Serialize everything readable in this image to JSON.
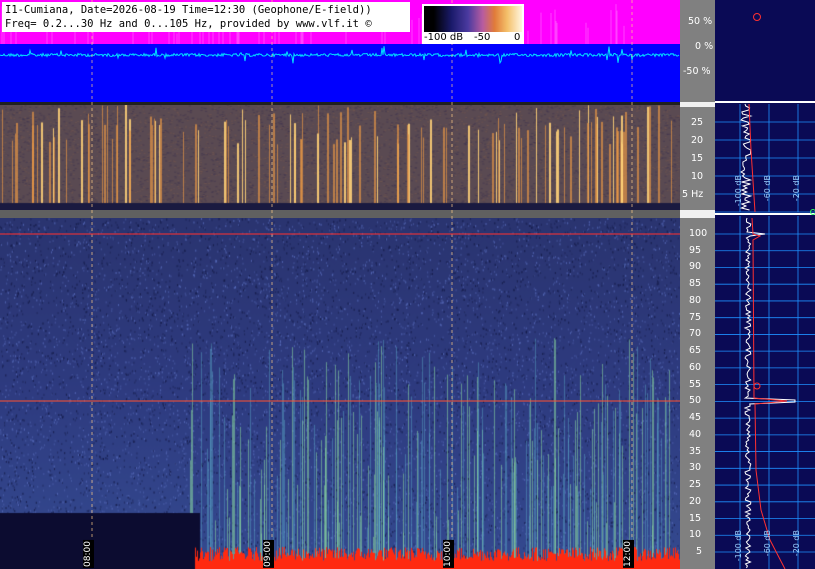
{
  "header": {
    "line1": "I1-Cumiana, Date=2026-08-19 Time=12:30 (Geophone/E-field))",
    "line2": "Freq= 0.2...30 Hz and 0...105 Hz, provided by www.vlf.it ©"
  },
  "colorbar": {
    "label_min": "-100 dB",
    "label_mid": "-50",
    "label_max": "0"
  },
  "colors": {
    "amplitude_bg": "#0000ff",
    "amplitude_fill": "#ff00ff",
    "trace": "#00e0ff",
    "spectrum_bg": "#2e3b78",
    "low_spectro_bg": "#5a4a52",
    "axis_panel": "#808080",
    "right_panel": "#0a0a55",
    "grid": "#1e90ff",
    "white_line": "#ffffff",
    "red_line": "#ff2020"
  },
  "chart_data": [
    {
      "type": "line",
      "panel": "amplitude",
      "yticks": [
        "50 %",
        "0 %",
        "-50 %"
      ],
      "ylim": [
        -100,
        100
      ]
    },
    {
      "type": "heatmap",
      "panel": "spectrogram-low",
      "ylabel_unit": "Hz",
      "yticks": [
        "25",
        "20",
        "15",
        "10",
        "5 Hz"
      ],
      "ylim": [
        0.2,
        30
      ],
      "time_labels": [
        "08:00",
        "09:00",
        "10:00",
        "12:00"
      ]
    },
    {
      "type": "heatmap",
      "panel": "spectrogram-high",
      "yticks": [
        "100",
        "95",
        "90",
        "85",
        "80",
        "75",
        "70",
        "65",
        "60",
        "55",
        "50",
        "45",
        "40",
        "35",
        "30",
        "25",
        "20",
        "15",
        "10",
        "5"
      ],
      "ylim": [
        0,
        105
      ],
      "time_labels": [
        "08:00",
        "09:00",
        "10:00",
        "12:00"
      ],
      "highlight_lines_hz": [
        50,
        100
      ]
    },
    {
      "type": "line",
      "panel": "spectrum-low",
      "xticks": [
        "-100 dB",
        "-60 dB",
        "-20 dB"
      ]
    },
    {
      "type": "line",
      "panel": "spectrum-high",
      "xticks": [
        "-100 dB",
        "-60 dB",
        "-20 dB"
      ]
    }
  ]
}
